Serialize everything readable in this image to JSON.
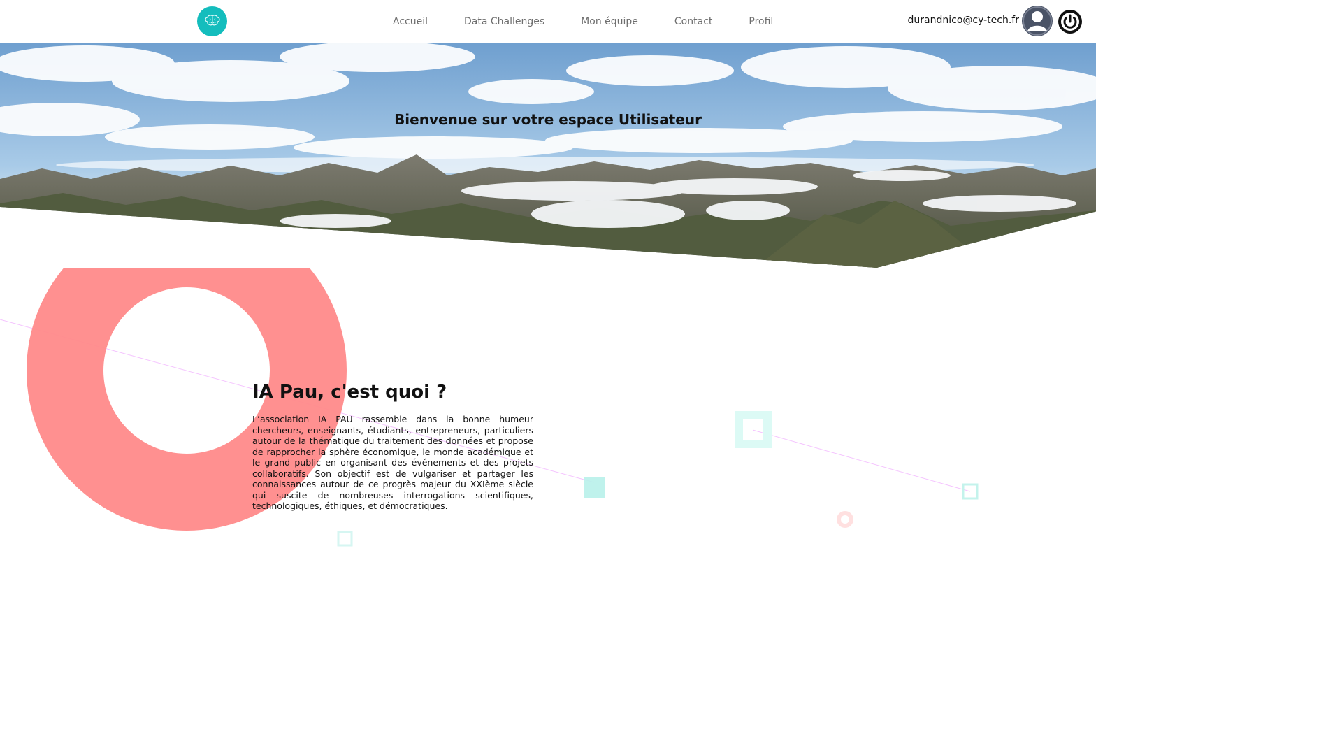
{
  "navbar": {
    "logo_icon": "brain-icon",
    "links": [
      {
        "label": "Accueil"
      },
      {
        "label": "Data Challenges"
      },
      {
        "label": "Mon équipe"
      },
      {
        "label": "Contact"
      },
      {
        "label": "Profil"
      }
    ],
    "user_email": "durandnico@cy-tech.fr",
    "avatar_icon": "user-avatar-icon",
    "logout_icon": "power-icon"
  },
  "hero": {
    "title": "Bienvenue sur votre espace Utilisateur",
    "image": "mountain-panorama"
  },
  "about": {
    "heading": "IA Pau, c'est quoi ?",
    "body": "L’association IA PAU rassemble dans la bonne humeur chercheurs, enseignants, étudiants, entrepreneurs, particuliers autour de la thématique du traitement des données et propose de rapprocher la sphère économique, le monde académique et le grand public en organisant des événements et des projets collaboratifs. Son objectif est de vulgariser et partager les connaissances autour de ce progrès majeur du XXIème siècle qui suscite de nombreuses interrogations scientifiques, technologiques, éthiques, et démocratiques."
  },
  "colors": {
    "accent": "#14bdbd",
    "ring": "#ff8a8a",
    "square": "#b8f1ea"
  }
}
